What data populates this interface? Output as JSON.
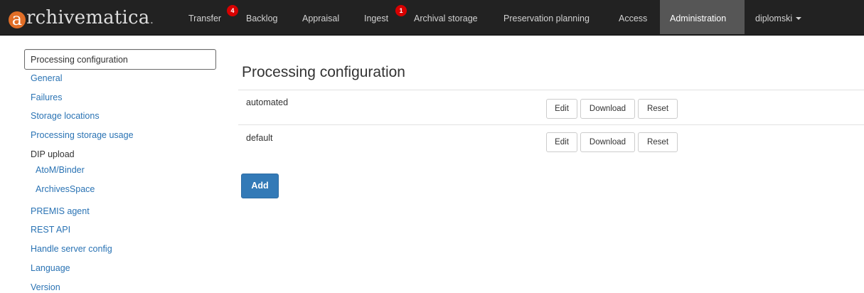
{
  "brand": {
    "logo_letter": "a",
    "name": "rchivematica",
    "dot": "."
  },
  "nav": {
    "transfer": "Transfer",
    "transfer_badge": "4",
    "backlog": "Backlog",
    "appraisal": "Appraisal",
    "ingest": "Ingest",
    "ingest_badge": "1",
    "archival_storage": "Archival storage",
    "preservation_planning": "Preservation planning",
    "access": "Access",
    "administration": "Administration",
    "user": "diplomski"
  },
  "sidebar": {
    "active": "Processing configuration",
    "general": "General",
    "failures": "Failures",
    "storage_locations": "Storage locations",
    "processing_storage_usage": "Processing storage usage",
    "dip_upload": "DIP upload",
    "atom_binder": "AtoM/Binder",
    "archivesspace": "ArchivesSpace",
    "premis_agent": "PREMIS agent",
    "rest_api": "REST API",
    "handle_server_config": "Handle server config",
    "language": "Language",
    "version": "Version"
  },
  "main": {
    "title": "Processing configuration",
    "rows": [
      {
        "name": "automated",
        "edit": "Edit",
        "download": "Download",
        "reset": "Reset"
      },
      {
        "name": "default",
        "edit": "Edit",
        "download": "Download",
        "reset": "Reset"
      }
    ],
    "add_label": "Add"
  },
  "colors": {
    "navbar_bg": "#222222",
    "nav_active_bg": "#565656",
    "badge": "#d80000",
    "logo_accent": "#e16e27",
    "link": "#2a73b4",
    "primary_button": "#337ab7"
  },
  "icons": {
    "user_menu": "caret-down-icon"
  }
}
